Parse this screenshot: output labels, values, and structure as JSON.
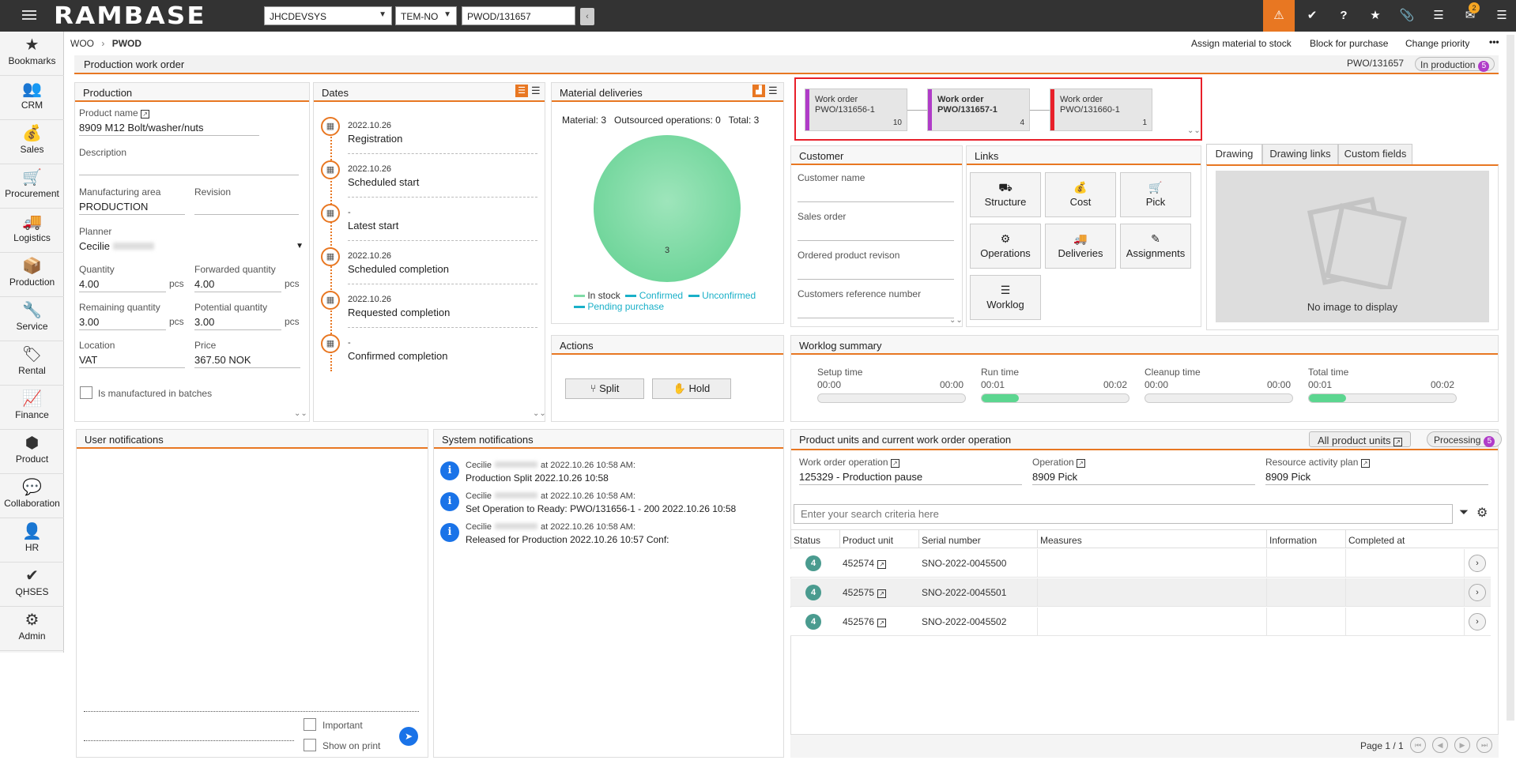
{
  "topbar": {
    "logo": "RAMBASE",
    "database": "JHCDEVSYS",
    "language": "TEM-NO",
    "object_input": "PWOD/131657",
    "message_badge": "2"
  },
  "nav": {
    "items": [
      {
        "label": "Bookmarks",
        "icon": "star-icon",
        "glyph": "★"
      },
      {
        "label": "CRM",
        "icon": "people-icon",
        "glyph": "👥"
      },
      {
        "label": "Sales",
        "icon": "money-bag-icon",
        "glyph": "💰"
      },
      {
        "label": "Procurement",
        "icon": "cart-icon",
        "glyph": "🛒"
      },
      {
        "label": "Logistics",
        "icon": "truck-icon",
        "glyph": "🚚"
      },
      {
        "label": "Production",
        "icon": "boxes-icon",
        "glyph": "📦"
      },
      {
        "label": "Service",
        "icon": "wrench-icon",
        "glyph": "🔧"
      },
      {
        "label": "Rental",
        "icon": "rental-icon",
        "glyph": "🏷"
      },
      {
        "label": "Finance",
        "icon": "chart-line-icon",
        "glyph": "📈"
      },
      {
        "label": "Product",
        "icon": "cube-icon",
        "glyph": "⬢"
      },
      {
        "label": "Collaboration",
        "icon": "chat-icon",
        "glyph": "💬"
      },
      {
        "label": "HR",
        "icon": "person-icon",
        "glyph": "👤"
      },
      {
        "label": "QHSES",
        "icon": "shield-check-icon",
        "glyph": "✔"
      },
      {
        "label": "Admin",
        "icon": "gear-icon",
        "glyph": "⚙"
      }
    ]
  },
  "breadcrumb": {
    "parent": "WOO",
    "separator": "›",
    "current": "PWOD"
  },
  "actions": {
    "assign": "Assign material to stock",
    "block": "Block for purchase",
    "priority": "Change priority",
    "more": "•••"
  },
  "header": {
    "title": "Production work order",
    "id": "PWO/131657",
    "status": "In production",
    "status_count": "5"
  },
  "production": {
    "title": "Production",
    "product_name_label": "Product name",
    "product_name": "8909 M12 Bolt/washer/nuts",
    "description_label": "Description",
    "description": "",
    "mfg_area_label": "Manufacturing area",
    "mfg_area": "PRODUCTION",
    "revision_label": "Revision",
    "revision": "",
    "planner_label": "Planner",
    "planner": "Cecilie",
    "quantity_label": "Quantity",
    "quantity": "4.00",
    "fwd_quantity_label": "Forwarded quantity",
    "fwd_quantity": "4.00",
    "remaining_label": "Remaining quantity",
    "remaining": "3.00",
    "potential_label": "Potential quantity",
    "potential": "3.00",
    "location_label": "Location",
    "location": "VAT",
    "price_label": "Price",
    "price": "367.50 NOK",
    "unit": "pcs",
    "batches_label": "Is manufactured in batches"
  },
  "dates": {
    "title": "Dates",
    "items": [
      {
        "date": "2022.10.26",
        "label": "Registration"
      },
      {
        "date": "2022.10.26",
        "label": "Scheduled start"
      },
      {
        "date": "-",
        "label": "Latest start"
      },
      {
        "date": "2022.10.26",
        "label": "Scheduled completion"
      },
      {
        "date": "2022.10.26",
        "label": "Requested completion"
      },
      {
        "date": "-",
        "label": "Confirmed completion"
      }
    ]
  },
  "material": {
    "title": "Material deliveries",
    "summary_material": "Material: 3",
    "summary_outsourced": "Outsourced operations: 0",
    "summary_total": "Total: 3",
    "pie_label": "3",
    "legend": [
      "In stock",
      "Confirmed",
      "Unconfirmed",
      "Pending purchase"
    ],
    "colors": {
      "in_stock": "#7fdba6",
      "confirmed": "#1ab0c8",
      "unconfirmed": "#1ab0c8",
      "pending": "#1ab0c8"
    }
  },
  "work_orders": [
    {
      "type": "Work order",
      "id": "PWO/131656-1",
      "count": "10",
      "color": "#b03cc8",
      "bold": false
    },
    {
      "type": "Work order",
      "id": "PWO/131657-1",
      "count": "4",
      "color": "#b03cc8",
      "bold": true
    },
    {
      "type": "Work order",
      "id": "PWO/131660-1",
      "count": "1",
      "color": "#e8202a",
      "bold": false
    }
  ],
  "customer": {
    "title": "Customer",
    "name_label": "Customer name",
    "sales_order_label": "Sales order",
    "ordered_rev_label": "Ordered product revison",
    "ref_label": "Customers reference number"
  },
  "links": {
    "title": "Links",
    "items": [
      {
        "label": "Structure",
        "icon": "structure-icon",
        "glyph": "⛟"
      },
      {
        "label": "Cost",
        "icon": "money-bag-icon",
        "glyph": "💰"
      },
      {
        "label": "Pick",
        "icon": "cart-icon",
        "glyph": "🛒"
      },
      {
        "label": "Operations",
        "icon": "gears-icon",
        "glyph": "⚙"
      },
      {
        "label": "Deliveries",
        "icon": "truck-icon",
        "glyph": "🚚"
      },
      {
        "label": "Assignments",
        "icon": "assign-icon",
        "glyph": "✎"
      },
      {
        "label": "Worklog",
        "icon": "list-icon",
        "glyph": "☰"
      }
    ]
  },
  "drawing": {
    "tabs": [
      "Drawing",
      "Drawing links",
      "Custom fields"
    ],
    "empty_text": "No image to display"
  },
  "actions_panel": {
    "title": "Actions",
    "split": "Split",
    "hold": "Hold"
  },
  "worklog": {
    "title": "Worklog summary",
    "items": [
      {
        "label": "Setup time",
        "actual": "00:00",
        "planned": "00:00",
        "progress": 0
      },
      {
        "label": "Run time",
        "actual": "00:01",
        "planned": "00:02",
        "progress": 0.25
      },
      {
        "label": "Cleanup time",
        "actual": "00:00",
        "planned": "00:00",
        "progress": 0
      },
      {
        "label": "Total time",
        "actual": "00:01",
        "planned": "00:02",
        "progress": 0.25
      }
    ]
  },
  "user_notifications": {
    "title": "User notifications",
    "important": "Important",
    "show_on_print": "Show on print"
  },
  "system_notifications": {
    "title": "System notifications",
    "items": [
      {
        "author": "Cecilie",
        "time": "at 2022.10.26 10:58 AM:",
        "text": "Production Split 2022.10.26 10:58"
      },
      {
        "author": "Cecilie",
        "time": "at 2022.10.26 10:58 AM:",
        "text": "Set Operation to Ready: PWO/131656-1 - 200 2022.10.26 10:58"
      },
      {
        "author": "Cecilie",
        "time": "at 2022.10.26 10:58 AM:",
        "text": "Released for Production 2022.10.26 10:57 Conf:"
      }
    ]
  },
  "product_units": {
    "title": "Product units and current work order operation",
    "all_units": "All product units",
    "processing": "Processing",
    "processing_count": "5",
    "wo_op_label": "Work order operation",
    "wo_op": "125329 - Production pause",
    "operation_label": "Operation",
    "operation": "8909 Pick",
    "rap_label": "Resource activity plan",
    "rap": "8909 Pick",
    "search_placeholder": "Enter your search criteria here",
    "columns": [
      "Status",
      "Product unit",
      "Serial number",
      "Measures",
      "Information",
      "Completed at"
    ],
    "rows": [
      {
        "status": "4",
        "unit": "452574",
        "serial": "SNO-2022-0045500"
      },
      {
        "status": "4",
        "unit": "452575",
        "serial": "SNO-2022-0045501"
      },
      {
        "status": "4",
        "unit": "452576",
        "serial": "SNO-2022-0045502"
      }
    ],
    "page": "Page 1 / 1"
  }
}
